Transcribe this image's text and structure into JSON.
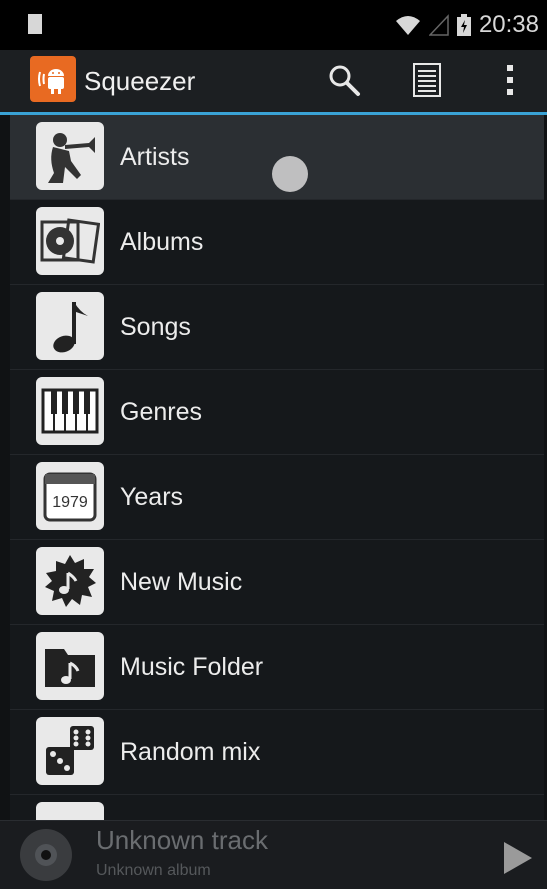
{
  "status": {
    "time": "20:38"
  },
  "app": {
    "title": "Squeezer"
  },
  "menu": [
    {
      "label": "Artists",
      "icon": "trumpet-player-icon"
    },
    {
      "label": "Albums",
      "icon": "albums-icon"
    },
    {
      "label": "Songs",
      "icon": "music-note-icon"
    },
    {
      "label": "Genres",
      "icon": "piano-keys-icon"
    },
    {
      "label": "Years",
      "icon": "calendar-icon",
      "year": "1979"
    },
    {
      "label": "New Music",
      "icon": "new-music-icon"
    },
    {
      "label": "Music Folder",
      "icon": "music-folder-icon"
    },
    {
      "label": "Random mix",
      "icon": "dice-icon"
    }
  ],
  "now_playing": {
    "track": "Unknown track",
    "album": "Unknown album"
  },
  "colors": {
    "accent": "#3aa3d6",
    "app_icon": "#e86a22"
  }
}
